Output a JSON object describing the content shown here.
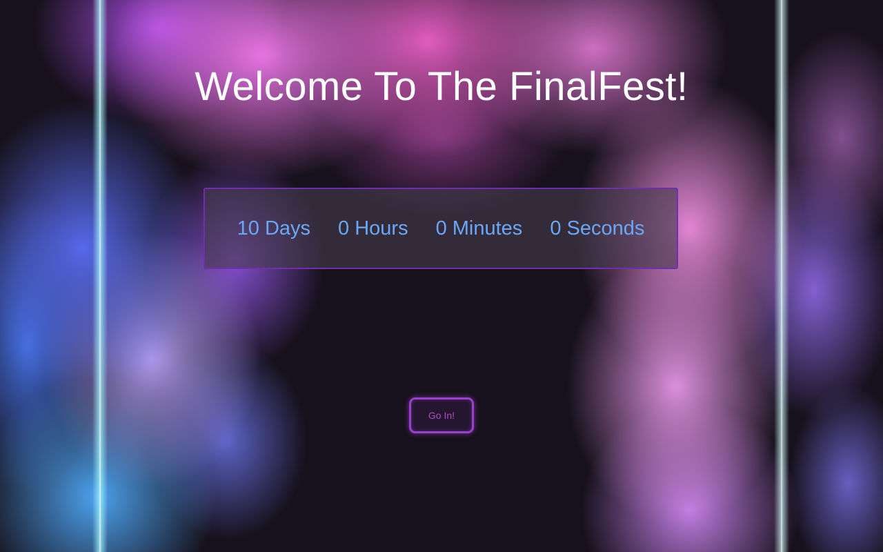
{
  "header": {
    "title": "Welcome To The FinalFest!"
  },
  "countdown": {
    "days": "10 Days",
    "hours": "0 Hours",
    "minutes": "0 Minutes",
    "seconds": "0 Seconds"
  },
  "actions": {
    "go_in_label": "Go In!"
  },
  "colors": {
    "countdown_text": "#6aa8f5",
    "countdown_border": "#6f2fae",
    "button_border": "#9a3fcf",
    "button_text": "#b04bc4",
    "title_text": "#ffffff"
  },
  "background": {
    "icon": "colored-smoke-background"
  }
}
